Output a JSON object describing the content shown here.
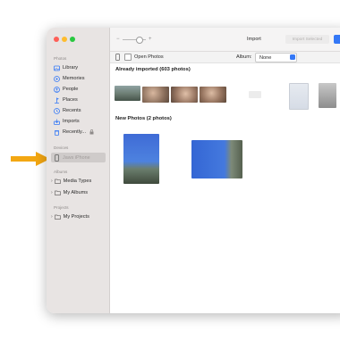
{
  "sidebar": {
    "sections": {
      "photos": "Photos",
      "devices": "Devices",
      "albums": "Albums",
      "projects": "Projects"
    },
    "items": [
      {
        "label": "Library",
        "icon": "library-icon"
      },
      {
        "label": "Memories",
        "icon": "memories-icon"
      },
      {
        "label": "People",
        "icon": "people-icon"
      },
      {
        "label": "Places",
        "icon": "places-icon"
      },
      {
        "label": "Recents",
        "icon": "recents-icon"
      },
      {
        "label": "Imports",
        "icon": "imports-icon"
      },
      {
        "label": "Recently...",
        "icon": "trash-icon"
      }
    ],
    "device_label": "Jaws iPhone",
    "album_items": [
      {
        "label": "Media Types"
      },
      {
        "label": "My Albums"
      }
    ],
    "project_items": [
      {
        "label": "My Projects"
      }
    ]
  },
  "toolbar": {
    "tab_label": "Import",
    "import_selected_label": "Import Selected"
  },
  "subbar": {
    "open_photos_label": "Open Photos",
    "album_label": "Album:",
    "album_value": "None"
  },
  "content": {
    "already_imported_heading": "Already imported (603 photos)",
    "new_photos_heading": "New Photos (2 photos)"
  },
  "colors": {
    "accent": "#3478f6",
    "annotation_arrow": "#f3a712",
    "sidebar_bg": "#e8e4e3"
  }
}
